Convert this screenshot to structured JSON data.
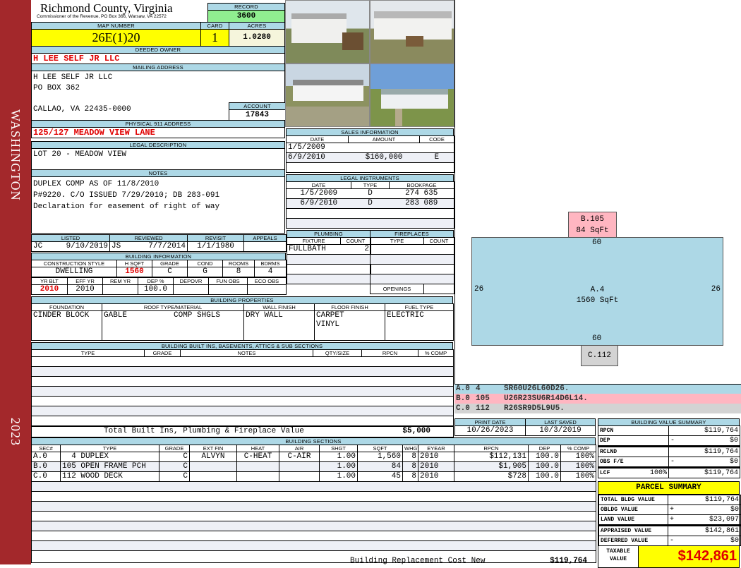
{
  "sidebar": {
    "district": "WASHINGTON",
    "year": "2023",
    "color": "#a3282b"
  },
  "header": {
    "title": "Richmond County, Virginia",
    "subtitle": "Commissioner of the Revenue, PO Box 366, Warsaw, VA 22572",
    "record_label": "RECORD",
    "record": "3600"
  },
  "map": {
    "map_label": "MAP NUMBER",
    "map_number": "26E(1)20",
    "card_label": "CARD",
    "card": "1",
    "acres_label": "ACRES",
    "acres": "1.0280"
  },
  "owner": {
    "label": "DEEDED OWNER",
    "value": "H LEE SELF JR LLC"
  },
  "mailing": {
    "label": "MAILING ADDRESS",
    "line1": "H LEE SELF JR LLC",
    "line2": "PO BOX 362",
    "line3": "CALLAO, VA 22435-0000",
    "account_label": "ACCOUNT",
    "account": "17843"
  },
  "physical": {
    "label": "PHYSICAL 911 ADDRESS",
    "value": "125/127 MEADOW VIEW LANE"
  },
  "legal": {
    "label": "LEGAL DESCRIPTION",
    "value": "LOT 20 - MEADOW VIEW"
  },
  "notes": {
    "label": "NOTES",
    "lines": [
      "DUPLEX COMP AS OF 11/8/2010",
      "P#9220. C/O ISSUED 7/29/2010; DB 283-091",
      "Declaration for easement of right of way"
    ]
  },
  "review": {
    "headers": [
      "LISTED",
      "REVIEWED",
      "REVISIT",
      "APPEALS"
    ],
    "listed_by": "JC",
    "listed": "9/10/2019",
    "reviewed_by": "JS",
    "reviewed": "7/7/2014",
    "revisit": "1/1/1980",
    "appeals": ""
  },
  "building_info": {
    "label": "BUILDING INFORMATION",
    "h1": [
      "CONSTRUCTION STYLE",
      "H SQFT",
      "GRADE",
      "COND",
      "ROOMS",
      "BDRMS"
    ],
    "v1": [
      "DWELLING",
      "1560",
      "C",
      "G",
      "8",
      "4"
    ],
    "h2": [
      "YR BLT",
      "EFF YR",
      "REM YR",
      "DEP %",
      "DEPOVR",
      "FUN OBS",
      "ECO OBS"
    ],
    "v2": [
      "2010",
      "2010",
      "",
      "100.0",
      "",
      "",
      ""
    ]
  },
  "properties": {
    "label": "BUILDING PROPERTIES",
    "headers": [
      "FOUNDATION",
      "ROOF TYPE/MATERIAL",
      "WALL FINISH",
      "FLOOR FINISH",
      "FUEL TYPE"
    ],
    "foundation": "CINDER BLOCK",
    "roof_type": "GABLE",
    "roof_material": "COMP SHGLS",
    "wall": "DRY WALL",
    "floor1": "CARPET",
    "floor2": "VINYL",
    "fuel": "ELECTRIC"
  },
  "builtins": {
    "label": "BUILDING BUILT INS, BASEMENTS, ATTICS & SUB SECTIONS",
    "headers": [
      "TYPE",
      "GRADE",
      "NOTES",
      "QTY/SIZE",
      "RPCN",
      "% COMP"
    ],
    "total_label": "Total Built Ins, Plumbing & Fireplace Value",
    "total": "$5,000"
  },
  "sales": {
    "label": "SALES INFORMATION",
    "headers": [
      "DATE",
      "AMOUNT",
      "CODE"
    ],
    "rows": [
      {
        "date": "1/5/2009",
        "amount": "",
        "code": ""
      },
      {
        "date": "6/9/2010",
        "amount": "$160,000",
        "code": "E"
      }
    ]
  },
  "instruments": {
    "label": "LEGAL INSTRUMENTS",
    "headers": [
      "DATE",
      "TYPE",
      "BOOKPAGE"
    ],
    "rows": [
      {
        "date": "1/5/2009",
        "type": "D",
        "bookpage": "274 635"
      },
      {
        "date": "6/9/2010",
        "type": "D",
        "bookpage": "283 089"
      }
    ]
  },
  "plumbing": {
    "label": "PLUMBING",
    "headers": [
      "FIXTURE",
      "COUNT"
    ],
    "fixture": "FULLBATH",
    "count": "2"
  },
  "fireplaces": {
    "label": "FIREPLACES",
    "headers": [
      "TYPE",
      "COUNT"
    ],
    "openings_label": "OPENINGS"
  },
  "sketch": {
    "a_label": "A.4",
    "a_area": "1560 SqFt",
    "b_label": "B.105",
    "b_area": "84 SqFt",
    "c_label": "C.112",
    "top": "60",
    "bottom": "60",
    "left": "26",
    "right": "26",
    "legend": [
      {
        "sec": "A.0",
        "code": "4",
        "path": "SR60U26L60D26.",
        "color": "#add8e6"
      },
      {
        "sec": "B.0",
        "code": "105",
        "path": "U26R23SU6R14D6L14.",
        "color": "#ffb6c1"
      },
      {
        "sec": "C.0",
        "code": "112",
        "path": "R26SR9D5L9U5.",
        "color": "#d3d3d3"
      }
    ]
  },
  "dates": {
    "print_label": "PRINT DATE",
    "print": "10/26/2023",
    "saved_label": "LAST SAVED",
    "saved": "10/3/2019"
  },
  "sections": {
    "label": "BUILDING SECTIONS",
    "headers": [
      "SEC#",
      "TYPE",
      "GRADE",
      "EXT FIN",
      "HEAT",
      "AIR",
      "SHGT",
      "SQFT",
      "WHGT",
      "EYEAR",
      "RPCN",
      "DEP",
      "% COMP"
    ],
    "rows": [
      [
        "A.0",
        "  4 DUPLEX",
        "C",
        "ALVYN",
        "C-HEAT",
        "C-AIR",
        "1.00",
        "1,560",
        "8",
        "2010",
        "$112,131",
        "100.0",
        "100%"
      ],
      [
        "B.0",
        "105 OPEN FRAME PCH",
        "C",
        "",
        "",
        "",
        "1.00",
        "84",
        "8",
        "2010",
        "$1,905",
        "100.0",
        "100%"
      ],
      [
        "C.0",
        "112 WOOD DECK",
        "C",
        "",
        "",
        "",
        "1.00",
        "45",
        "8",
        "2010",
        "$728",
        "100.0",
        "100%"
      ]
    ],
    "total_label": "Building Replacement Cost New",
    "total": "$119,764"
  },
  "value_summary": {
    "label": "BUILDING VALUE SUMMARY",
    "rpcn_label": "RPCN",
    "rpcn": "$119,764",
    "dep_label": "DEP",
    "dep_sign": "-",
    "dep": "$0",
    "rclnd_label": "RCLND",
    "rclnd": "$119,764",
    "obs_label": "OBS F/E",
    "obs_sign": "-",
    "obs": "$0",
    "lcf_label": "LCF",
    "lcf_pct": "100%",
    "lcf": "$119,764"
  },
  "parcel": {
    "label": "PARCEL SUMMARY",
    "total_bldg_label": "TOTAL BLDG VALUE",
    "total_bldg": "$119,764",
    "obldg_label": "OBLDG VALUE",
    "obldg_sign": "+",
    "obldg": "$0",
    "land_label": "LAND VALUE",
    "land_sign": "+",
    "land": "$23,097",
    "appraised_label": "APPRAISED VALUE",
    "appraised": "$142,861",
    "deferred_label": "DEFERRED VALUE",
    "deferred_sign": "-",
    "deferred": "$0",
    "taxable_label1": "TAXABLE",
    "taxable_label2": "VALUE",
    "taxable": "$142,861"
  }
}
